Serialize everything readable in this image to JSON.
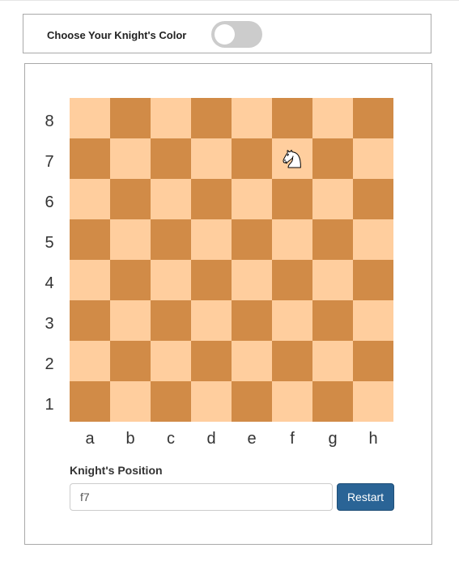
{
  "header": {
    "label": "Choose Your Knight's Color",
    "toggle_on": false
  },
  "board": {
    "ranks": [
      "8",
      "7",
      "6",
      "5",
      "4",
      "3",
      "2",
      "1"
    ],
    "files": [
      "a",
      "b",
      "c",
      "d",
      "e",
      "f",
      "g",
      "h"
    ],
    "light_color": "#ffce9e",
    "dark_color": "#d18b47",
    "knight": {
      "square": "f7",
      "piece": "knight-icon",
      "color": "white"
    }
  },
  "position": {
    "label": "Knight's Position",
    "value": "f7"
  },
  "actions": {
    "restart_label": "Restart",
    "restart_color": "#2a6496"
  }
}
